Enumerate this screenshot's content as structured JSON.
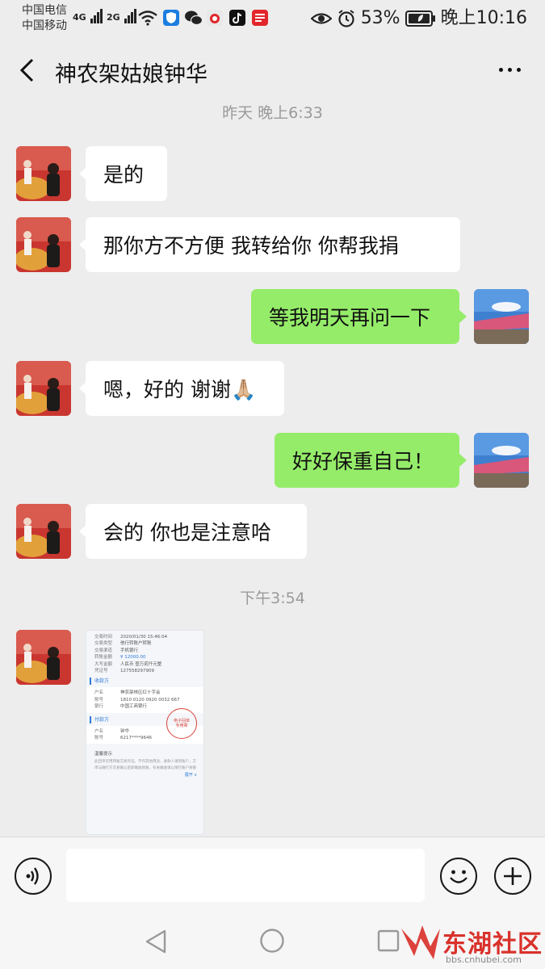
{
  "status_bar": {
    "carrier1": "中国电信",
    "carrier2": "中国移动",
    "net1": "4G",
    "net2": "2G",
    "battery": "53%",
    "time": "晚上10:16"
  },
  "header": {
    "back_icon": "chevron-left-icon",
    "title": "神农架姑娘钟华",
    "more_icon": "more-dots-icon"
  },
  "timestamps": {
    "t1": "昨天 晚上6:33",
    "t2": "下午3:54"
  },
  "messages": [
    {
      "side": "in",
      "text": "是的"
    },
    {
      "side": "in",
      "text": "那你方不方便  我转给你  你帮我捐"
    },
    {
      "side": "out",
      "text": "等我明天再问一下"
    },
    {
      "side": "in",
      "text": "嗯，好的 谢谢🙏🏼"
    },
    {
      "side": "out",
      "text": "好好保重自己！"
    },
    {
      "side": "in",
      "text": "会的 你也是注意哈"
    }
  ],
  "receipt": {
    "rows_top": [
      {
        "k": "交易时间",
        "v": "2020/01/30 15:46:04"
      },
      {
        "k": "交易类型",
        "v": "他行转账户转账"
      },
      {
        "k": "交易渠道",
        "v": "手机银行"
      },
      {
        "k": "转账金额",
        "v": "¥ 12000.00"
      },
      {
        "k": "大写金额",
        "v": "人民币 壹万贰仟元整"
      },
      {
        "k": "凭证号",
        "v": "127558297909"
      }
    ],
    "section_payee": "收款方",
    "rows_payee": [
      {
        "k": "户名",
        "v": "神农架林区红十字会"
      },
      {
        "k": "账号",
        "v": "1810 0120 0920 0032 667"
      },
      {
        "k": "银行",
        "v": "中国工商银行"
      }
    ],
    "section_payer": "付款方",
    "rows_payer": [
      {
        "k": "户名",
        "v": "钟华"
      },
      {
        "k": "账号",
        "v": "6217****9646"
      }
    ],
    "notice_title": "温馨提示",
    "notice_text": "此回单仅用转账交易凭证，不作其他用途，收款人请到账户，方",
    "notice_text2": "审与确行方交易确认后即确收款账，有关确收请以银行账户余额",
    "expand_label": "展开",
    "stamp_text": "电子回单专用章"
  },
  "input_bar": {
    "voice_icon": "voice-icon",
    "emoji_icon": "emoji-icon",
    "plus_icon": "plus-icon"
  },
  "watermark": {
    "name": "东湖社区",
    "url": "bbs.cnhubei.com"
  },
  "colors": {
    "background": "#ededed",
    "bubble_out": "#95ec69",
    "bubble_in": "#ffffff"
  }
}
